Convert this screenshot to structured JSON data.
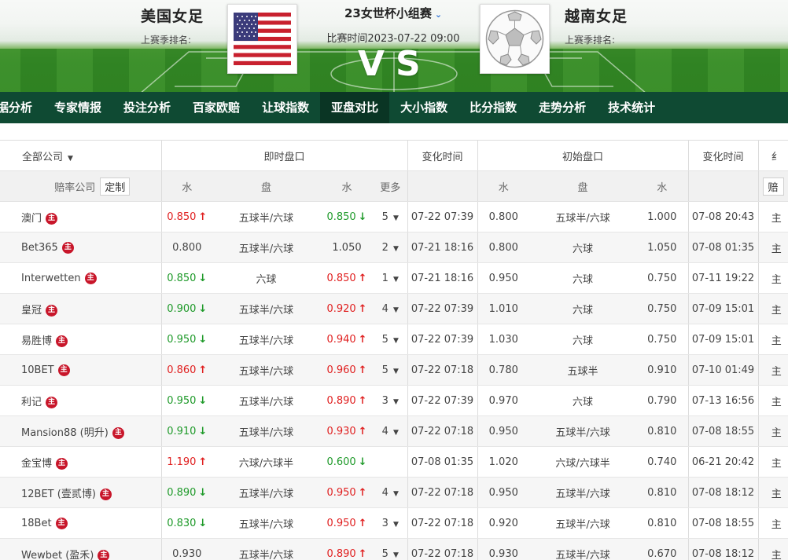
{
  "header": {
    "home_team": "美国女足",
    "home_rank_label": "上赛季排名:",
    "away_team": "越南女足",
    "away_rank_label": "上赛季排名:",
    "league": "23女世杯小组赛",
    "match_time": "比赛时间2023-07-22 09:00",
    "vs": "VS"
  },
  "nav": [
    "据分析",
    "专家情报",
    "投注分析",
    "百家欧赔",
    "让球指数",
    "亚盘对比",
    "大小指数",
    "比分指数",
    "走势分析",
    "技术统计"
  ],
  "nav_active": 5,
  "table": {
    "all_companies": "全部公司",
    "live_group": "即时盘口",
    "change_time": "变化时间",
    "init_group": "初始盘口",
    "change_time2": "变化时间",
    "extra_head": "纟",
    "company_col": "赔率公司",
    "custom_btn": "定制",
    "water": "水",
    "handicap": "盘",
    "water2": "水",
    "more": "更多",
    "init_water": "水",
    "init_handicap": "盘",
    "init_water2": "水",
    "extra_sub": "赔",
    "badge_text": "主",
    "rows": [
      {
        "company": "澳门",
        "w1": "0.850",
        "w1d": "up",
        "pan": "五球半/六球",
        "w2": "0.850",
        "w2d": "down",
        "more": "5",
        "time": "07-22 07:39",
        "iw1": "0.800",
        "ipan": "五球半/六球",
        "iw2": "1.000",
        "itime": "07-08 20:43",
        "extra": "主"
      },
      {
        "company": "Bet365",
        "w1": "0.800",
        "w1d": "",
        "pan": "五球半/六球",
        "w2": "1.050",
        "w2d": "",
        "more": "2",
        "time": "07-21 18:16",
        "iw1": "0.800",
        "ipan": "六球",
        "iw2": "1.050",
        "itime": "07-08 01:35",
        "extra": "主"
      },
      {
        "company": "Interwetten",
        "w1": "0.850",
        "w1d": "down",
        "pan": "六球",
        "w2": "0.850",
        "w2d": "up",
        "more": "1",
        "time": "07-21 18:16",
        "iw1": "0.950",
        "ipan": "六球",
        "iw2": "0.750",
        "itime": "07-11 19:22",
        "extra": "主"
      },
      {
        "company": "皇冠",
        "w1": "0.900",
        "w1d": "down",
        "pan": "五球半/六球",
        "w2": "0.920",
        "w2d": "up",
        "more": "4",
        "time": "07-22 07:39",
        "iw1": "1.010",
        "ipan": "六球",
        "iw2": "0.750",
        "itime": "07-09 15:01",
        "extra": "主"
      },
      {
        "company": "易胜博",
        "w1": "0.950",
        "w1d": "down",
        "pan": "五球半/六球",
        "w2": "0.940",
        "w2d": "up",
        "more": "5",
        "time": "07-22 07:39",
        "iw1": "1.030",
        "ipan": "六球",
        "iw2": "0.750",
        "itime": "07-09 15:01",
        "extra": "主"
      },
      {
        "company": "10BET",
        "w1": "0.860",
        "w1d": "up",
        "pan": "五球半/六球",
        "w2": "0.960",
        "w2d": "up",
        "more": "5",
        "time": "07-22 07:18",
        "iw1": "0.780",
        "ipan": "五球半",
        "iw2": "0.910",
        "itime": "07-10 01:49",
        "extra": "主"
      },
      {
        "company": "利记",
        "w1": "0.950",
        "w1d": "down",
        "pan": "五球半/六球",
        "w2": "0.890",
        "w2d": "up",
        "more": "3",
        "time": "07-22 07:39",
        "iw1": "0.970",
        "ipan": "六球",
        "iw2": "0.790",
        "itime": "07-13 16:56",
        "extra": "主"
      },
      {
        "company": "Mansion88 (明升)",
        "w1": "0.910",
        "w1d": "down",
        "pan": "五球半/六球",
        "w2": "0.930",
        "w2d": "up",
        "more": "4",
        "time": "07-22 07:18",
        "iw1": "0.950",
        "ipan": "五球半/六球",
        "iw2": "0.810",
        "itime": "07-08 18:55",
        "extra": "主"
      },
      {
        "company": "金宝博",
        "w1": "1.190",
        "w1d": "up",
        "pan": "六球/六球半",
        "w2": "0.600",
        "w2d": "down",
        "more": "",
        "time": "07-08 01:35",
        "iw1": "1.020",
        "ipan": "六球/六球半",
        "iw2": "0.740",
        "itime": "06-21 20:42",
        "extra": "主"
      },
      {
        "company": "12BET (壹贰博)",
        "w1": "0.890",
        "w1d": "down",
        "pan": "五球半/六球",
        "w2": "0.950",
        "w2d": "up",
        "more": "4",
        "time": "07-22 07:18",
        "iw1": "0.950",
        "ipan": "五球半/六球",
        "iw2": "0.810",
        "itime": "07-08 18:12",
        "extra": "主"
      },
      {
        "company": "18Bet",
        "w1": "0.830",
        "w1d": "down",
        "pan": "五球半/六球",
        "w2": "0.950",
        "w2d": "up",
        "more": "3",
        "time": "07-22 07:18",
        "iw1": "0.920",
        "ipan": "五球半/六球",
        "iw2": "0.810",
        "itime": "07-08 18:55",
        "extra": "主"
      },
      {
        "company": "Wewbet (盈禾)",
        "w1": "0.930",
        "w1d": "",
        "pan": "五球半/六球",
        "w2": "0.890",
        "w2d": "up",
        "more": "5",
        "time": "07-22 07:18",
        "iw1": "0.930",
        "ipan": "五球半/六球",
        "iw2": "0.670",
        "itime": "07-08 18:12",
        "extra": "主"
      }
    ]
  },
  "colors": {
    "nav_bg": "#0f4a33",
    "nav_active": "#0a3524",
    "up": "#e02020",
    "down": "#1f9a2a",
    "badge": "#c8162a"
  }
}
